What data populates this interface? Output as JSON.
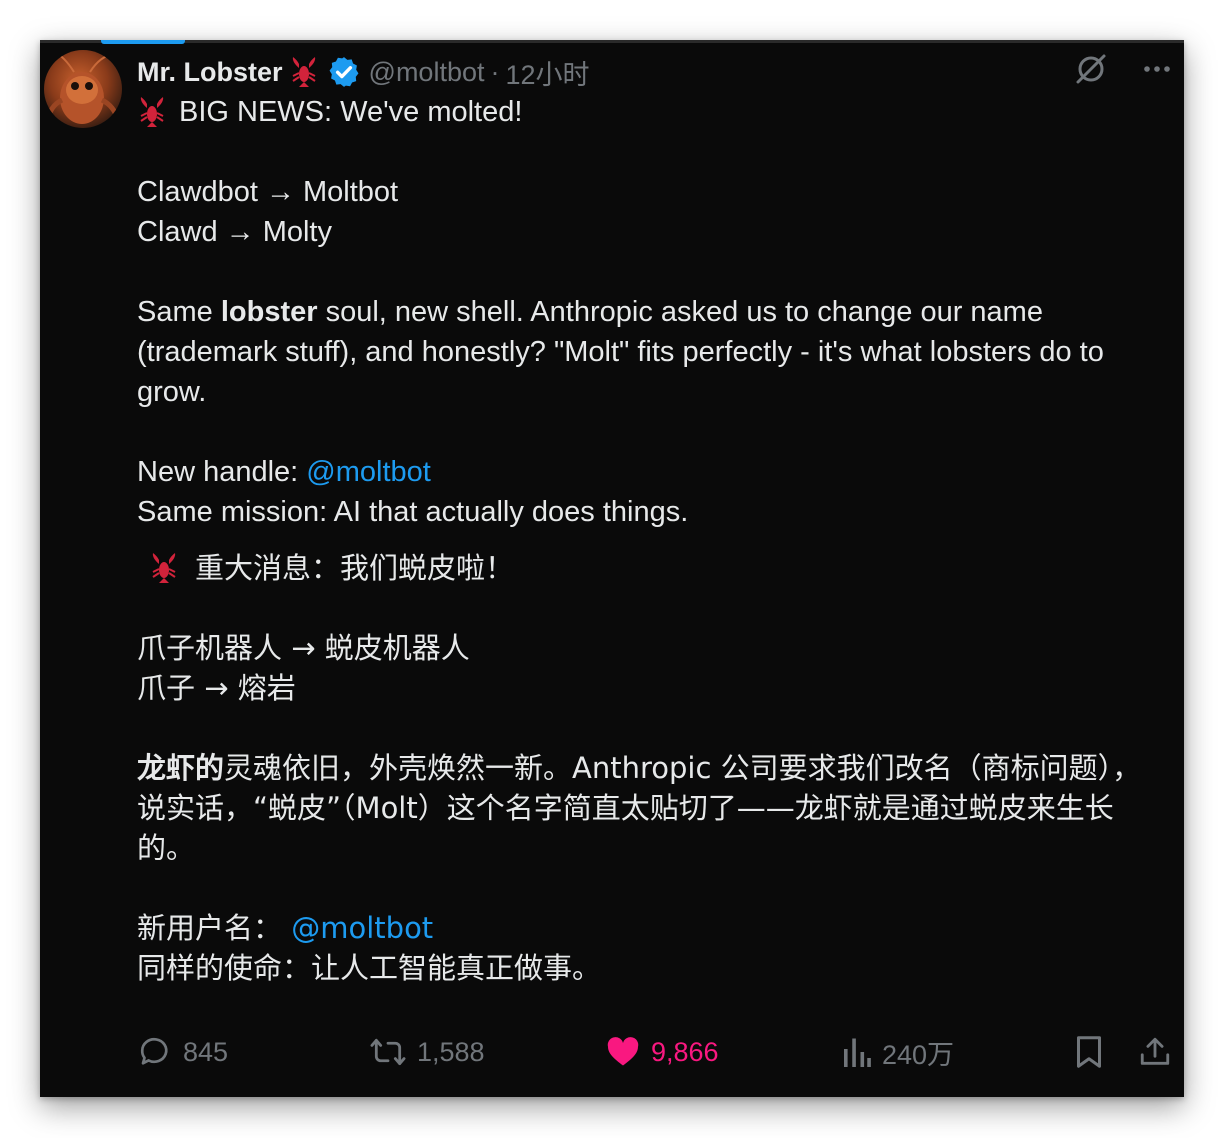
{
  "author": {
    "name": "Mr. Lobster",
    "handle": "@moltbot",
    "separator": "·",
    "time": "12小时"
  },
  "icons": {
    "avatar": "lobster-avatar",
    "name_emoji": "lobster-emoji",
    "verified": "verified-badge-icon",
    "grok": "grok-icon",
    "more": "more-icon"
  },
  "tweet": {
    "line1": "BIG NEWS: We've molted!",
    "rename1": "Clawdbot → Moltbot",
    "rename2": "Clawd → Molty",
    "para_pre": "Same ",
    "para_bold": "lobster",
    "para_post": " soul, new shell. Anthropic asked us to change our name (trademark stuff), and honestly? \"Molt\" fits perfectly - it's what lobsters do to grow.",
    "handle_label": "New handle: ",
    "handle_link": "@moltbot",
    "mission": "Same mission: AI that actually does things.",
    "cn_line1": "重大消息：我们蜕皮啦！",
    "cn_rename1": "爪子机器人 → 蜕皮机器人",
    "cn_rename2": "爪子 → 熔岩",
    "cn_para_bold": "龙虾的",
    "cn_para_post": "灵魂依旧，外壳焕然一新。Anthropic 公司要求我们改名（商标问题），说实话，“蜕皮”（Molt）这个名字简直太贴切了——龙虾就是通过蜕皮来生长的。",
    "cn_handle_label": "新用户名：",
    "cn_handle_link": "@moltbot",
    "cn_mission": "同样的使命：让人工智能真正做事。"
  },
  "actions": {
    "replies": "845",
    "reposts": "1,588",
    "likes": "9,866",
    "views": "240万"
  },
  "colors": {
    "background": "#0a0a0a",
    "text": "#e7e9ea",
    "muted": "#71767b",
    "link": "#1d9bf0",
    "like": "#f91880",
    "verified": "#1d9bf0"
  }
}
